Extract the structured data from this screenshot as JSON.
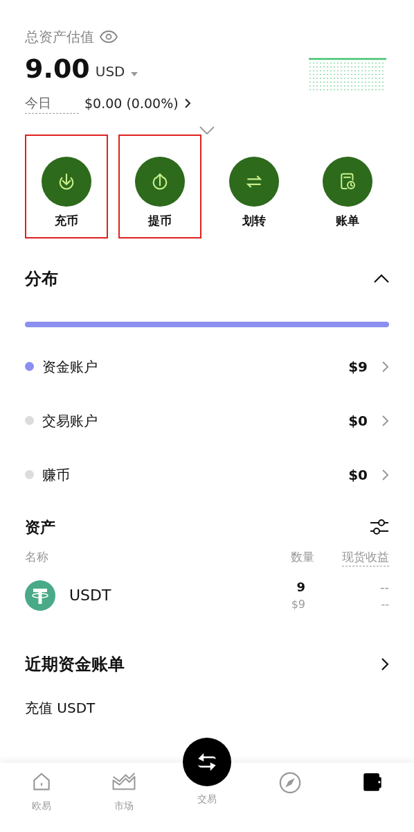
{
  "header": {
    "title": "总资产估值",
    "amount": "9.00",
    "currency": "USD",
    "today_label": "今日",
    "today_pnl": "$0.00 (0.00%)"
  },
  "actions": [
    {
      "kind": "deposit",
      "label": "充币",
      "highlighted": true
    },
    {
      "kind": "withdraw",
      "label": "提币",
      "highlighted": true
    },
    {
      "kind": "transfer",
      "label": "划转",
      "highlighted": false
    },
    {
      "kind": "bill",
      "label": "账单",
      "highlighted": false
    }
  ],
  "distribution": {
    "title": "分布",
    "expanded": true,
    "level": 1,
    "accounts": [
      {
        "name": "资金账户",
        "value": "$9",
        "color": "#8b8ff0"
      },
      {
        "name": "交易账户",
        "value": "$0",
        "color": "#dcdcdc"
      },
      {
        "name": "赚币",
        "value": "$0",
        "color": "#dcdcdc"
      }
    ]
  },
  "assets": {
    "title": "资产",
    "columns": [
      "名称",
      "数量",
      "现货收益"
    ],
    "rows": [
      {
        "symbol": "USDT",
        "amount": "9",
        "value": "$9",
        "pnl": "--",
        "pnl_pct": "--"
      }
    ]
  },
  "recent_bills": {
    "title": "近期资金账单",
    "first_entry": "充值 USDT"
  },
  "bottom_nav": [
    {
      "kind": "home",
      "label": "欧易",
      "selected": false
    },
    {
      "kind": "market",
      "label": "市场",
      "selected": false
    },
    {
      "kind": "trade",
      "label": "交易",
      "selected": false
    },
    {
      "kind": "explore",
      "selected": false
    },
    {
      "kind": "wallet",
      "selected": true
    }
  ]
}
